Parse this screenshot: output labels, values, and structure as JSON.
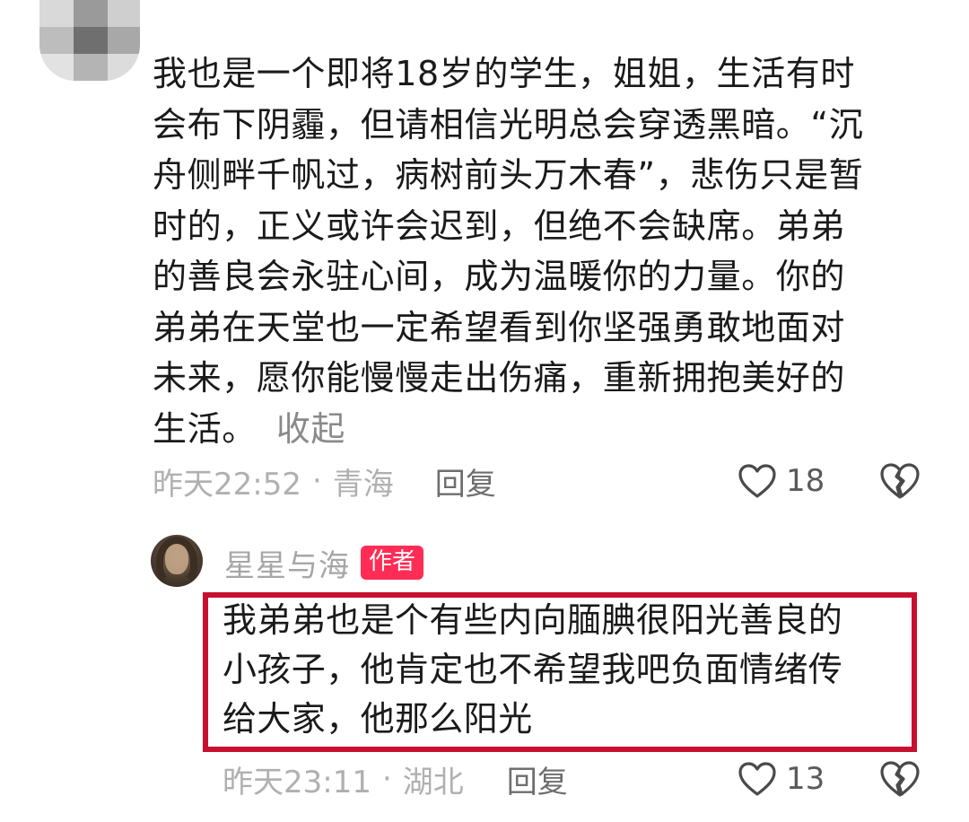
{
  "comment": {
    "lines": [
      "我也是一个即将18岁的学生，姐姐，生活有时",
      "会布下阴霾，但请相信光明总会穿透黑暗。“沉",
      "舟侧畔千帆过，病树前头万木春”，悲伤只是暂",
      "时的，正义或许会迟到，但绝不会缺席。弟弟",
      "的善良会永驻心间，成为温暖你的力量。你的",
      "弟弟在天堂也一定希望看到你坚强勇敢地面对",
      "未来，愿你能慢慢走出伤痛，重新拥抱美好的",
      "生活。"
    ],
    "collapse_label": "收起",
    "time": "昨天22:52",
    "separator": "·",
    "location": "青海",
    "reply_label": "回复",
    "like_count": "18",
    "like_icon": "heart-outline-icon",
    "dislike_icon": "broken-heart-icon"
  },
  "reply": {
    "author_name": "星星与海",
    "author_badge": "作者",
    "lines": [
      "我弟弟也是个有些内向腼腆很阳光善良的",
      "小孩子，他肯定也不希望我吧负面情绪传",
      "给大家，他那么阳光"
    ],
    "time": "昨天23:11",
    "separator": "·",
    "location": "湖北",
    "reply_label": "回复",
    "like_count": "13",
    "like_icon": "heart-outline-icon",
    "dislike_icon": "broken-heart-icon"
  },
  "colors": {
    "badge": "#ff2d55",
    "highlight_border": "#c8102e",
    "meta_text": "#b0b0b0"
  }
}
